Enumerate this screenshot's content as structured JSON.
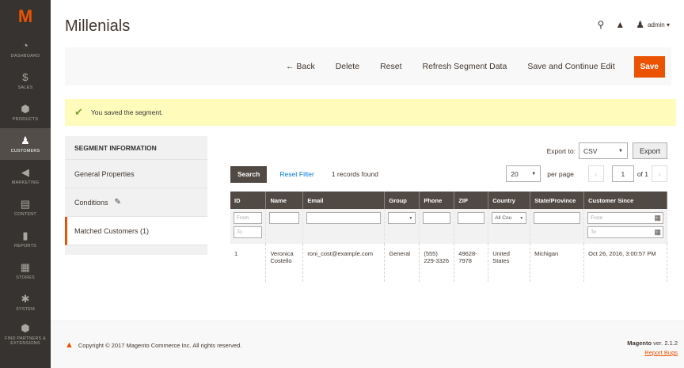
{
  "sidebar": {
    "logo": "M",
    "items": [
      {
        "label": "Dashboard",
        "icon": "dashboard-icon",
        "glyph": "◔"
      },
      {
        "label": "Sales",
        "icon": "dollar-icon",
        "glyph": "$"
      },
      {
        "label": "Products",
        "icon": "box-icon",
        "glyph": "⬢"
      },
      {
        "label": "Customers",
        "icon": "person-icon",
        "glyph": "♟"
      },
      {
        "label": "Marketing",
        "icon": "megaphone-icon",
        "glyph": "◀"
      },
      {
        "label": "Content",
        "icon": "content-icon",
        "glyph": "▤"
      },
      {
        "label": "Reports",
        "icon": "bar-chart-icon",
        "glyph": "▮"
      },
      {
        "label": "Stores",
        "icon": "store-icon",
        "glyph": "▦"
      },
      {
        "label": "System",
        "icon": "gear-icon",
        "glyph": "✱"
      },
      {
        "label": "Find Partners & Extensions",
        "icon": "cube-icon",
        "glyph": "⬢"
      }
    ]
  },
  "header": {
    "title": "Millenials",
    "user": "admin ▾"
  },
  "toolbar": {
    "back": "← Back",
    "delete": "Delete",
    "reset": "Reset",
    "refresh": "Refresh Segment Data",
    "save_continue": "Save and Continue Edit",
    "save": "Save"
  },
  "message": "You saved the segment.",
  "tabs": {
    "heading": "Segment Information",
    "items": [
      "General Properties",
      "Conditions",
      "Matched Customers (1)"
    ]
  },
  "grid": {
    "export_label": "Export to:",
    "export_format": "CSV",
    "export_button": "Export",
    "search_button": "Search",
    "reset_filter": "Reset Filter",
    "records": "1 records found",
    "per_page_value": "20",
    "per_page_label": "per page",
    "page": "1",
    "of_pages": "of 1",
    "columns": [
      "ID",
      "Name",
      "Email",
      "Group",
      "Phone",
      "ZIP",
      "Country",
      "State/Province",
      "Customer Since"
    ],
    "filters": {
      "from": "From",
      "to": "To",
      "country": "All Cou"
    },
    "rows": [
      {
        "id": "1",
        "name": "Veronica Costello",
        "email": "roni_cost@example.com",
        "group": "General",
        "phone": "(555) 229-3326",
        "zip": "49628-7978",
        "country": "United States",
        "state": "Michigan",
        "since": "Oct 26, 2016, 3:00:57 PM"
      }
    ]
  },
  "footer": {
    "copyright": "Copyright © 2017 Magento Commerce Inc. All rights reserved.",
    "brand": "Magento",
    "version": "ver. 2.1.2",
    "report": "Report Bugs"
  }
}
